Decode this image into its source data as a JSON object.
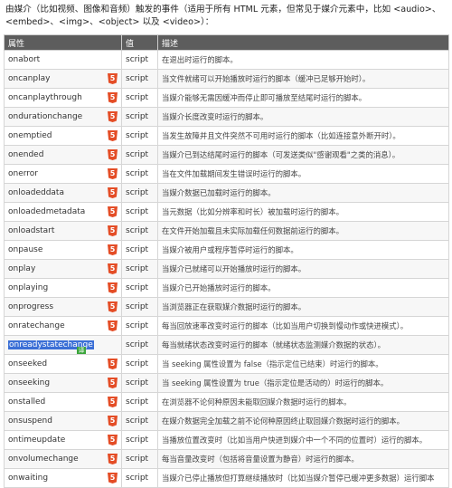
{
  "intro": "由媒介（比如视频、图像和音频）触发的事件（适用于所有 HTML 元素，但常见于媒介元素中，比如 <audio>、<embed>、<img>、<object> 以及 <video>）：",
  "table": {
    "headers": [
      "属性",
      "值",
      "描述"
    ],
    "rows": [
      {
        "attr": "onabort",
        "html5": false,
        "value": "script",
        "desc": "在退出时运行的脚本。"
      },
      {
        "attr": "oncanplay",
        "html5": true,
        "value": "script",
        "desc": "当文件就绪可以开始播放时运行的脚本（缓冲已足够开始时）。"
      },
      {
        "attr": "oncanplaythrough",
        "html5": true,
        "value": "script",
        "desc": "当媒介能够无需因缓冲而停止即可播放至结尾时运行的脚本。"
      },
      {
        "attr": "ondurationchange",
        "html5": true,
        "value": "script",
        "desc": "当媒介长度改变时运行的脚本。"
      },
      {
        "attr": "onemptied",
        "html5": true,
        "value": "script",
        "desc": "当发生故障并且文件突然不可用时运行的脚本（比如连接意外断开时）。"
      },
      {
        "attr": "onended",
        "html5": true,
        "value": "script",
        "desc": "当媒介已到达结尾时运行的脚本（可发送类似\"感谢观看\"之类的消息）。"
      },
      {
        "attr": "onerror",
        "html5": true,
        "value": "script",
        "desc": "当在文件加载期间发生错误时运行的脚本。"
      },
      {
        "attr": "onloadeddata",
        "html5": true,
        "value": "script",
        "desc": "当媒介数据已加载时运行的脚本。"
      },
      {
        "attr": "onloadedmetadata",
        "html5": true,
        "value": "script",
        "desc": "当元数据（比如分辨率和时长）被加载时运行的脚本。"
      },
      {
        "attr": "onloadstart",
        "html5": true,
        "value": "script",
        "desc": "在文件开始加载且未实际加载任何数据前运行的脚本。"
      },
      {
        "attr": "onpause",
        "html5": true,
        "value": "script",
        "desc": "当媒介被用户或程序暂停时运行的脚本。"
      },
      {
        "attr": "onplay",
        "html5": true,
        "value": "script",
        "desc": "当媒介已就绪可以开始播放时运行的脚本。"
      },
      {
        "attr": "onplaying",
        "html5": true,
        "value": "script",
        "desc": "当媒介已开始播放时运行的脚本。"
      },
      {
        "attr": "onprogress",
        "html5": true,
        "value": "script",
        "desc": "当浏览器正在获取媒介数据时运行的脚本。"
      },
      {
        "attr": "onratechange",
        "html5": true,
        "value": "script",
        "desc": "每当回放速率改变时运行的脚本（比如当用户切换到慢动作或快进模式）。"
      },
      {
        "attr": "onreadystatechange",
        "html5": false,
        "value": "script",
        "desc": "每当就绪状态改变时运行的脚本（就绪状态监测媒介数据的状态）。"
      },
      {
        "attr": "onseeked",
        "html5": true,
        "value": "script",
        "desc": "当 seeking 属性设置为 false（指示定位已结束）时运行的脚本。"
      },
      {
        "attr": "onseeking",
        "html5": true,
        "value": "script",
        "desc": "当 seeking 属性设置为 true（指示定位是活动的）时运行的脚本。"
      },
      {
        "attr": "onstalled",
        "html5": true,
        "value": "script",
        "desc": "在浏览器不论何种原因未能取回媒介数据时运行的脚本。"
      },
      {
        "attr": "onsuspend",
        "html5": true,
        "value": "script",
        "desc": "在媒介数据完全加载之前不论何种原因终止取回媒介数据时运行的脚本。"
      },
      {
        "attr": "ontimeupdate",
        "html5": true,
        "value": "script",
        "desc": "当播放位置改变时（比如当用户快进到媒介中一个不同的位置时）运行的脚本。"
      },
      {
        "attr": "onvolumechange",
        "html5": true,
        "value": "script",
        "desc": "每当音量改变时（包括将音量设置为静音）时运行的脚本。"
      },
      {
        "attr": "onwaiting",
        "html5": true,
        "value": "script",
        "desc": "当媒介已停止播放但打算继续播放时（比如当媒介暂停已缓冲更多数据）运行脚本"
      }
    ]
  },
  "html5_badge": "5",
  "translate_badge": "译",
  "colors": {
    "header_bg": "#5d5d5d",
    "html5_badge": "#e44d26",
    "highlight": "#3b6fd6",
    "translate_badge": "#3aa53a"
  }
}
